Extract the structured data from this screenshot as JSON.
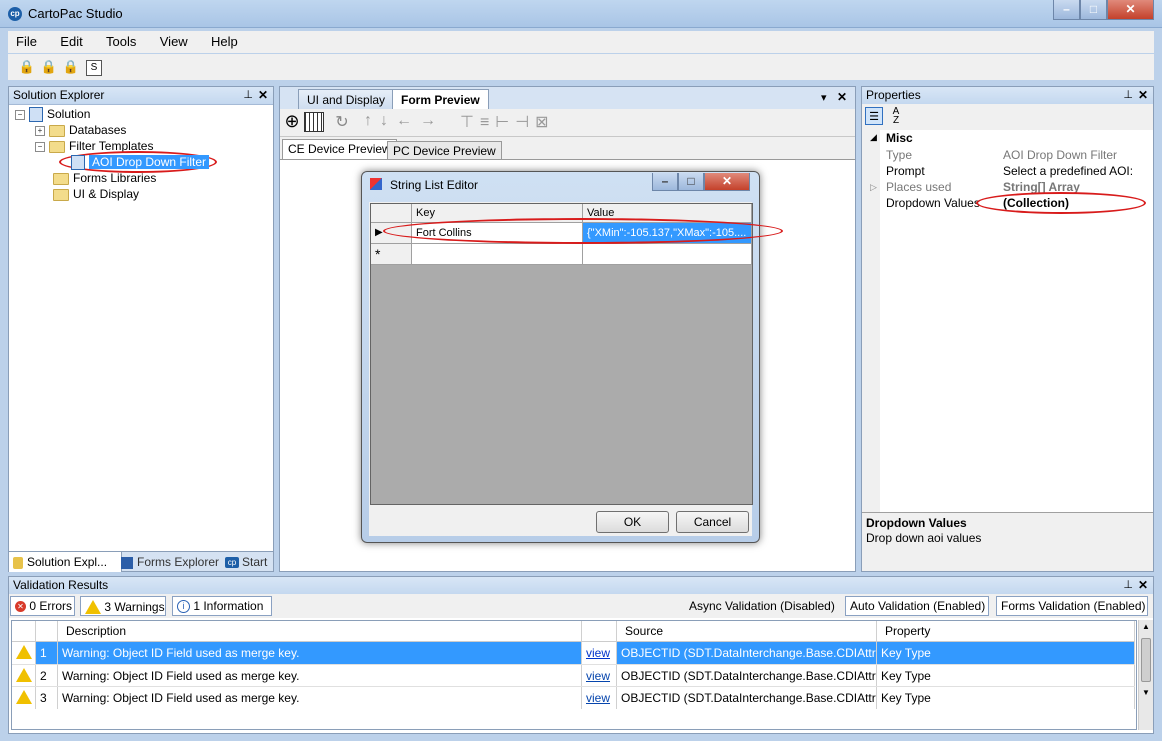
{
  "window": {
    "title": "CartoPac Studio",
    "logo_text": "cp"
  },
  "menu": [
    "File",
    "Edit",
    "Tools",
    "View",
    "Help"
  ],
  "solution_explorer": {
    "title": "Solution Explorer",
    "root": "Solution",
    "items": [
      {
        "label": "Databases"
      },
      {
        "label": "Filter Templates"
      },
      {
        "label": "AOI Drop Down Filter"
      },
      {
        "label": "Forms Libraries"
      },
      {
        "label": "UI & Display"
      }
    ],
    "bottom_tabs": [
      "Solution Expl...",
      "Forms Explorer",
      "Start"
    ]
  },
  "center": {
    "tabs": [
      "UI and Display",
      "Form Preview"
    ],
    "preview_tabs": [
      "CE Device Preview",
      "PC Device Preview"
    ]
  },
  "dialog": {
    "title": "String List Editor",
    "columns": [
      "Key",
      "Value"
    ],
    "rows": [
      {
        "key": "Fort Collins",
        "value": "{\"XMin\":-105.137,\"XMax\":-105...."
      }
    ],
    "new_row_marker": "*",
    "ok": "OK",
    "cancel": "Cancel"
  },
  "properties": {
    "title": "Properties",
    "category": "Misc",
    "rows": [
      {
        "name": "Type",
        "value": "AOI Drop Down Filter"
      },
      {
        "name": "Prompt",
        "value": "Select a predefined AOI:"
      },
      {
        "name": "Places used",
        "value": "String[] Array"
      },
      {
        "name": "Dropdown Values",
        "value": "(Collection)"
      }
    ],
    "desc_title": "Dropdown Values",
    "desc_text": "Drop down aoi values"
  },
  "validation": {
    "title": "Validation Results",
    "errors": "0 Errors",
    "warnings": "3 Warnings",
    "information": "1 Information",
    "async": "Async Validation (Disabled)",
    "auto": "Auto Validation (Enabled)",
    "forms": "Forms Validation (Enabled)",
    "columns": [
      "Description",
      "Source",
      "Property"
    ],
    "rows": [
      {
        "num": "1",
        "desc": "Warning: Object ID Field used as merge key.",
        "link": "view",
        "source": "OBJECTID (SDT.DataInterchange.Base.CDIAttribu...",
        "property": "Key Type"
      },
      {
        "num": "2",
        "desc": "Warning: Object ID Field used as merge key.",
        "link": "view",
        "source": "OBJECTID (SDT.DataInterchange.Base.CDIAttribu...",
        "property": "Key Type"
      },
      {
        "num": "3",
        "desc": "Warning: Object ID Field used as merge key.",
        "link": "view",
        "source": "OBJECTID (SDT.DataInterchange.Base.CDIAttribu...",
        "property": "Key Type"
      }
    ]
  },
  "colors": {
    "selection": "#3399ff",
    "highlight_ring": "#d81b1b",
    "warning": "#f0c000"
  }
}
